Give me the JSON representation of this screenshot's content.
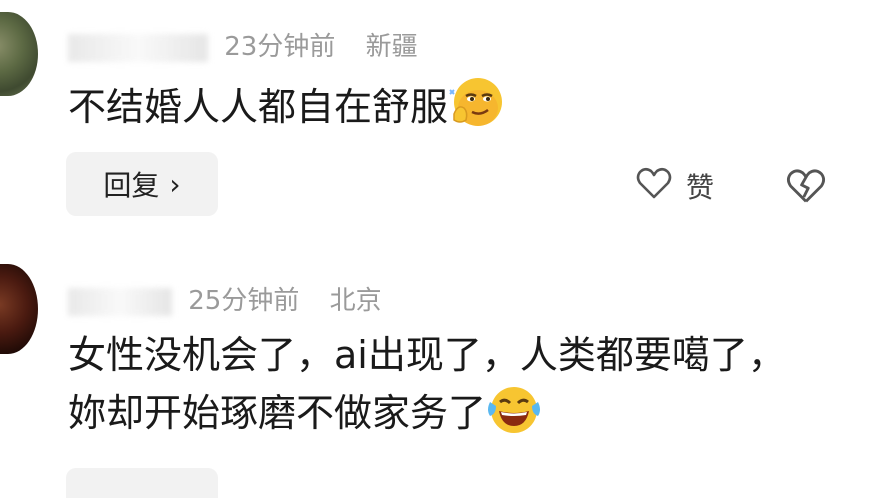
{
  "comments": [
    {
      "time": "23分钟前",
      "location": "新疆",
      "text": "不结婚人人都自在舒服",
      "emoji": "smirking-face-with-hand-emoji",
      "reply_label": "回复",
      "like_label": "赞"
    },
    {
      "time": "25分钟前",
      "location": "北京",
      "text_line1": "女性没机会了，ai出现了，人类都要噶了，",
      "text_line2": "妳却开始琢磨不做家务了",
      "emoji": "laughing-tears-emoji"
    }
  ],
  "colors": {
    "meta": "#9a9a9a",
    "text": "#1a1a1a",
    "button_bg": "#f2f2f2",
    "emoji_yellow": "#f7c531"
  }
}
